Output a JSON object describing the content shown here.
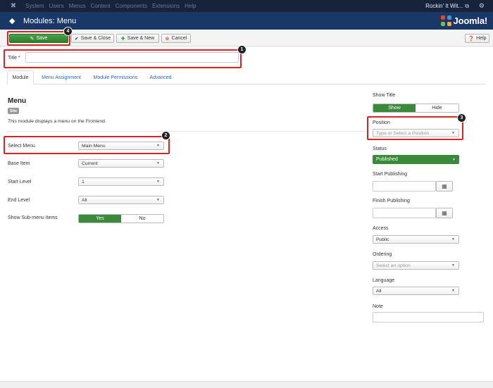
{
  "topnav": {
    "menu": [
      "System",
      "Users",
      "Menus",
      "Content",
      "Components",
      "Extensions",
      "Help"
    ],
    "site_name": "Rockin' It Wit...",
    "site_link_icon": "external-link-icon",
    "settings_icon": "gear-icon"
  },
  "header": {
    "title": "Modules: Menu",
    "brand": "Joomla!"
  },
  "toolbar": {
    "save_label": "Save",
    "save_close_label": "Save & Close",
    "save_new_label": "Save & New",
    "cancel_label": "Cancel",
    "help_label": "Help"
  },
  "callouts": [
    "1",
    "2",
    "3",
    "4"
  ],
  "form": {
    "title_label": "Title *",
    "title_value": ""
  },
  "tabs": [
    "Module",
    "Menu Assignment",
    "Module Permissions",
    "Advanced"
  ],
  "module": {
    "name": "Menu",
    "badge": "Site",
    "description": "This module displays a menu on the Frontend."
  },
  "fields": {
    "select_menu": {
      "label": "Select Menu",
      "value": "Main Menu"
    },
    "base_item": {
      "label": "Base Item",
      "value": "Current"
    },
    "start_level": {
      "label": "Start Level",
      "value": "1"
    },
    "end_level": {
      "label": "End Level",
      "value": "All"
    },
    "show_submenu": {
      "label": "Show Sub-menu Items",
      "yes": "Yes",
      "no": "No"
    }
  },
  "sidebar": {
    "show_title": {
      "label": "Show Title",
      "show": "Show",
      "hide": "Hide"
    },
    "position": {
      "label": "Position",
      "placeholder": "Type or Select a Position"
    },
    "status": {
      "label": "Status",
      "value": "Published"
    },
    "start_publishing": {
      "label": "Start Publishing"
    },
    "finish_publishing": {
      "label": "Finish Publishing"
    },
    "access": {
      "label": "Access",
      "value": "Public"
    },
    "ordering": {
      "label": "Ordering",
      "placeholder": "Select an option"
    },
    "language": {
      "label": "Language",
      "value": "All"
    },
    "note": {
      "label": "Note"
    }
  },
  "colors": {
    "nav_bg": "#17233a",
    "header_bg": "#1a3867",
    "success": "#3b8a3b",
    "callout_red": "#dd2222"
  }
}
